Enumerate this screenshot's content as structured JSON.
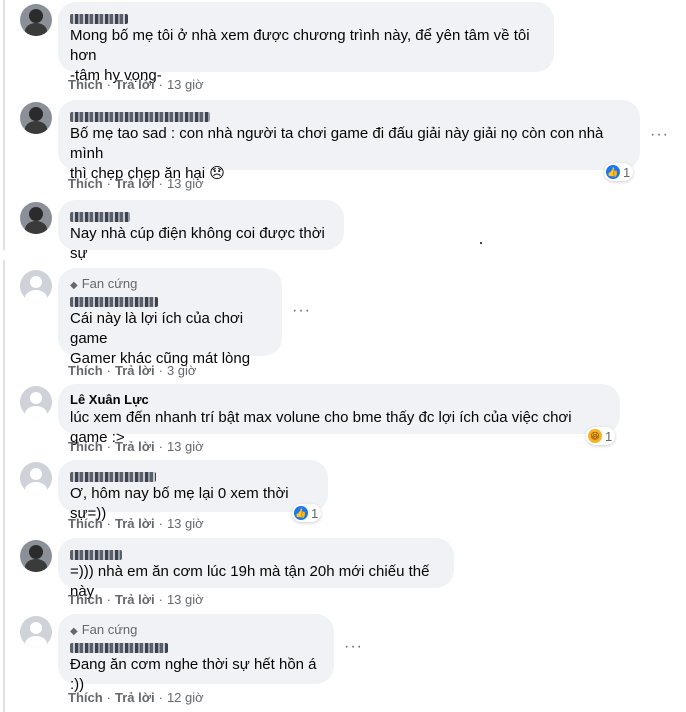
{
  "comments": [
    {
      "text": "Mong bố mẹ tôi ở nhà xem được chương trình này, để yên tâm về tôi hơn\n-tâm hy vọng-",
      "like": "Thích",
      "reply": "Trả lời",
      "time": "13 giờ"
    },
    {
      "text": "Bố mẹ tao sad : con nhà người ta chơi game đi đấu giải này giải nọ còn con nhà mình\nthì chẹp chẹp ăn hại 😞",
      "like": "Thích",
      "reply": "Trả lời",
      "time": "13 giờ",
      "reaction_count": "1",
      "reaction_icon": "like-icon"
    },
    {
      "text": "Nay nhà cúp điện không coi được thời sự"
    },
    {
      "badge": "Fan cứng",
      "text": "Cái này là lợi ích của chơi game\nGamer khác cũng mát lòng",
      "like": "Thích",
      "reply": "Trả lời",
      "time": "3 giờ"
    },
    {
      "name": "Lê Xuân Lực",
      "text": "lúc xem đến nhanh trí bật max volune cho bme thấy đc lợi ích của việc chơi game :>",
      "like": "Thích",
      "reply": "Trả lời",
      "time": "13 giờ",
      "reaction_count": "1",
      "reaction_icon": "haha-icon"
    },
    {
      "text": "Ơ, hôm nay bố mẹ lại 0 xem thời sự=))",
      "like": "Thích",
      "reply": "Trả lời",
      "time": "13 giờ",
      "reaction_count": "1",
      "reaction_icon": "like-icon"
    },
    {
      "text": "=))) nhà em ăn cơm lúc 19h mà tận 20h mới chiếu thế này",
      "like": "Thích",
      "reply": "Trả lời",
      "time": "13 giờ"
    },
    {
      "badge": "Fan cứng",
      "text": "Đang ăn cơm nghe thời sự hết hồn á :))",
      "like": "Thích",
      "reply": "Trả lời",
      "time": "12 giờ"
    }
  ],
  "more_icon": "more-options-icon",
  "colors": {
    "bubble": "#f0f2f5",
    "meta": "#65676b",
    "like_blue": "#1877f2"
  }
}
